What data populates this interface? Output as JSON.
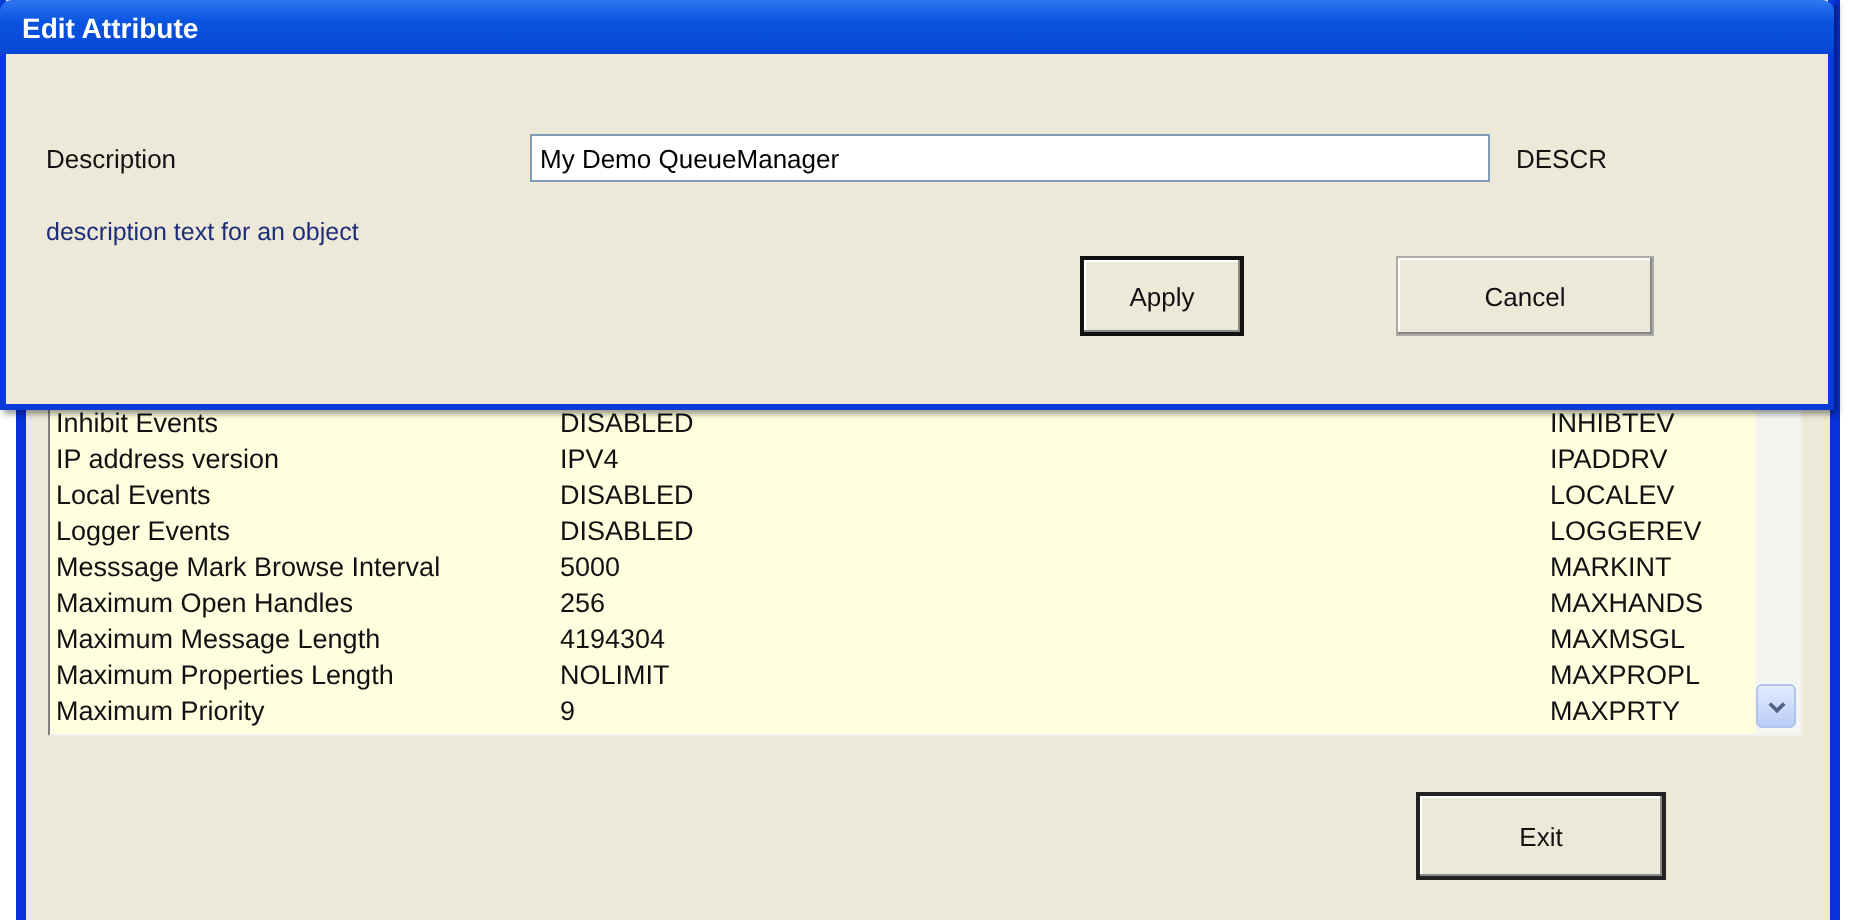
{
  "main_window": {
    "attributes": [
      {
        "name": "Inhibit Events",
        "value": "DISABLED",
        "parameter": "INHIBTEV"
      },
      {
        "name": "IP address version",
        "value": "IPV4",
        "parameter": "IPADDRV"
      },
      {
        "name": "Local Events",
        "value": "DISABLED",
        "parameter": "LOCALEV"
      },
      {
        "name": "Logger Events",
        "value": "DISABLED",
        "parameter": "LOGGEREV"
      },
      {
        "name": "Messsage Mark Browse Interval",
        "value": "5000",
        "parameter": "MARKINT"
      },
      {
        "name": "Maximum Open Handles",
        "value": "256",
        "parameter": "MAXHANDS"
      },
      {
        "name": "Maximum Message Length",
        "value": "4194304",
        "parameter": "MAXMSGL"
      },
      {
        "name": "Maximum Properties Length",
        "value": "NOLIMIT",
        "parameter": "MAXPROPL"
      },
      {
        "name": "Maximum Priority",
        "value": "9",
        "parameter": "MAXPRTY"
      }
    ],
    "exit_button": "Exit"
  },
  "dialog": {
    "title": "Edit Attribute",
    "field": {
      "label": "Description",
      "value": "My Demo QueueManager",
      "parameter": "DESCR"
    },
    "help_text": "description text for an object",
    "buttons": [
      {
        "label": "Apply",
        "default": true
      },
      {
        "label": "Cancel",
        "default": false
      }
    ]
  }
}
